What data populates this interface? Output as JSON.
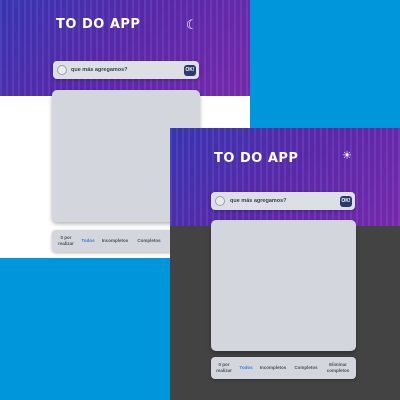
{
  "colors": {
    "background": "#0096dc",
    "light_panel": "#ffffff",
    "dark_panel": "#434343",
    "hero_start": "#3b38b8",
    "hero_end": "#7a2bb2",
    "card": "#d4d6dd",
    "active_filter": "#3a7bd5",
    "ok_button": "#2b3a6b"
  },
  "light": {
    "title": "TO DO APP",
    "theme_icon": "moon-icon",
    "theme_glyph": "☾",
    "input_placeholder": "que más agregamos?",
    "ok_label": "OK!",
    "footer": {
      "items_left": "0 por realizar",
      "filter_all": "Todos",
      "filter_incomplete": "Incompletos",
      "filter_complete": "Completos"
    }
  },
  "dark": {
    "title": "TO DO APP",
    "theme_icon": "sun-icon",
    "theme_glyph": "☀",
    "input_placeholder": "que más agregamos?",
    "ok_label": "OK!",
    "footer": {
      "items_left": "0 por realizar",
      "filter_all": "Todos",
      "filter_incomplete": "Incompletos",
      "filter_complete": "Completos",
      "clear_completed": "Eliminar completos"
    }
  }
}
